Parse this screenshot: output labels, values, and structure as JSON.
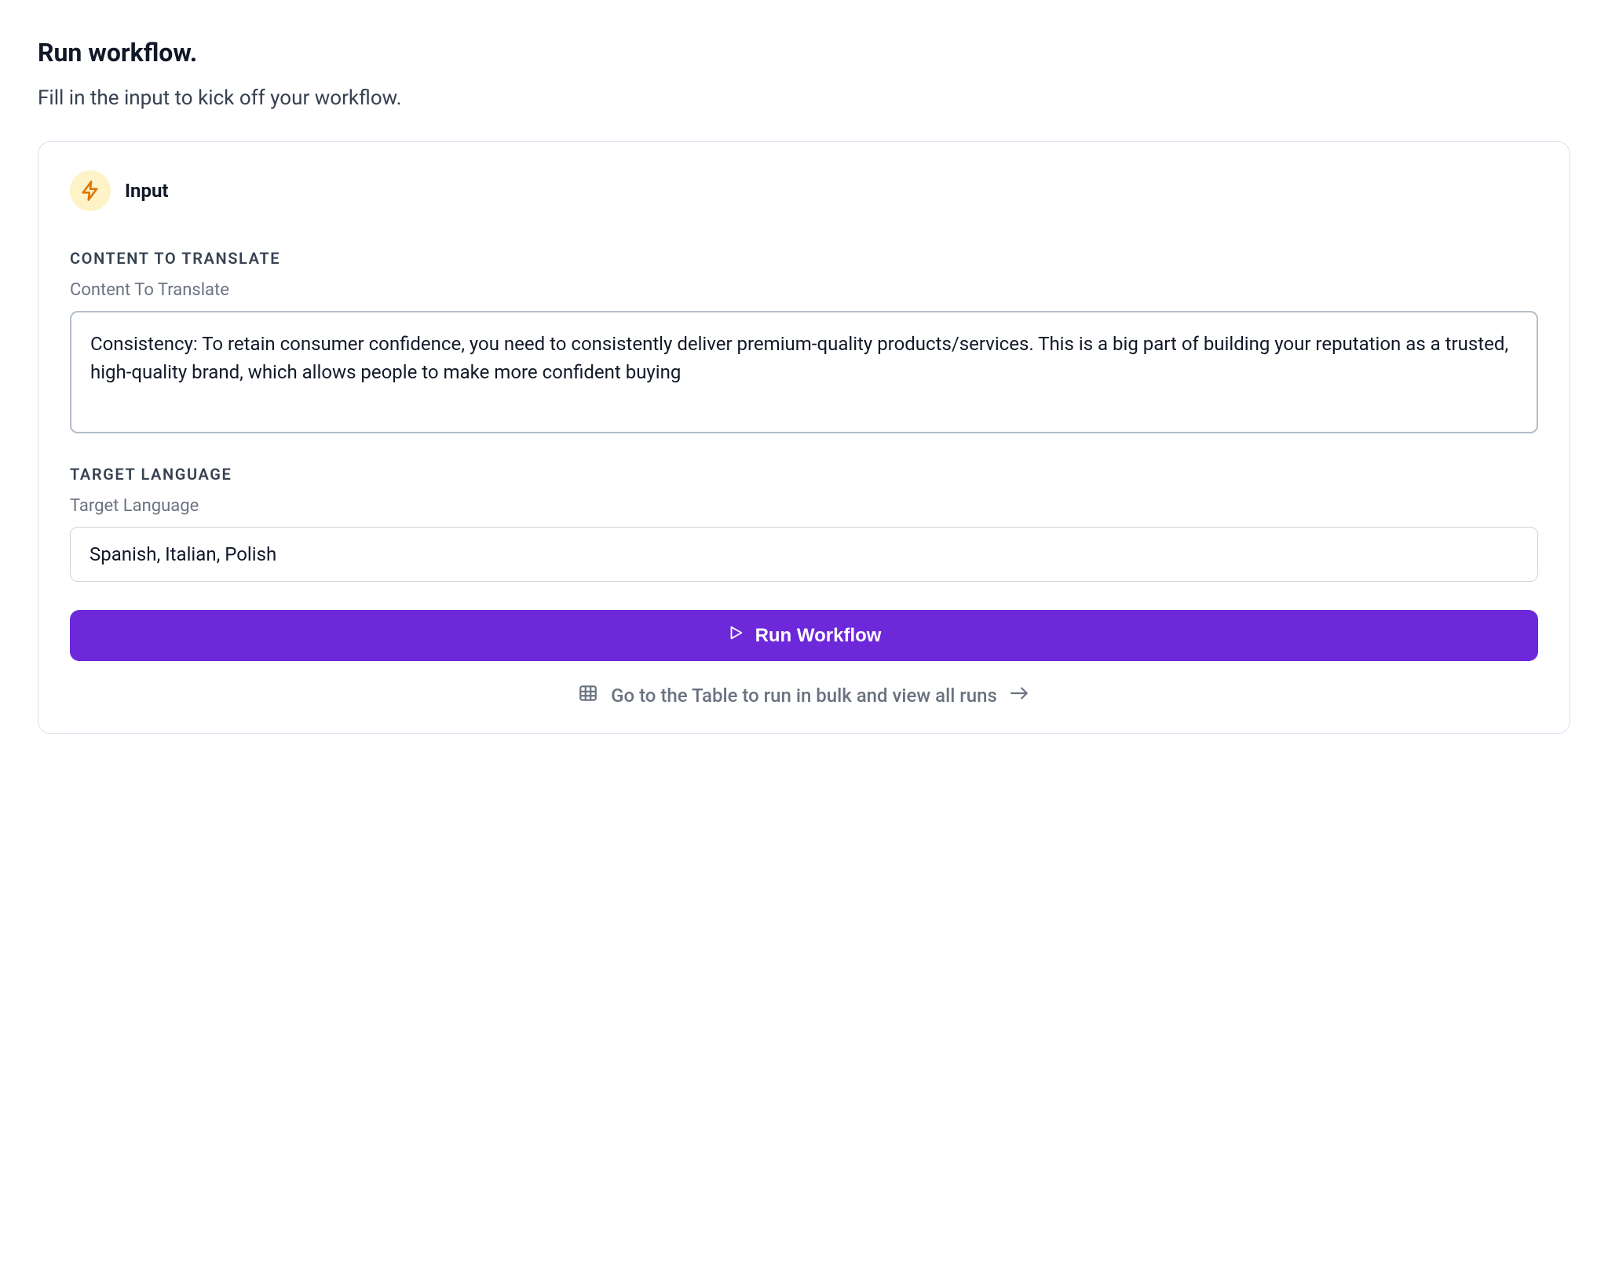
{
  "header": {
    "title": "Run workflow.",
    "subtitle": "Fill in the input to kick off your workflow."
  },
  "card": {
    "title": "Input",
    "fields": {
      "content": {
        "heading": "CONTENT TO TRANSLATE",
        "label": "Content To Translate",
        "value": "Consistency: To retain consumer confidence, you need to consistently deliver premium-quality products/services. This is a big part of building your reputation as a trusted, high-quality brand, which allows people to make more confident buying"
      },
      "language": {
        "heading": "TARGET LANGUAGE",
        "label": "Target Language",
        "value": "Spanish, Italian, Polish"
      }
    },
    "actions": {
      "run_label": "Run Workflow",
      "table_link_label": "Go to the Table to run in bulk and view all runs"
    }
  }
}
